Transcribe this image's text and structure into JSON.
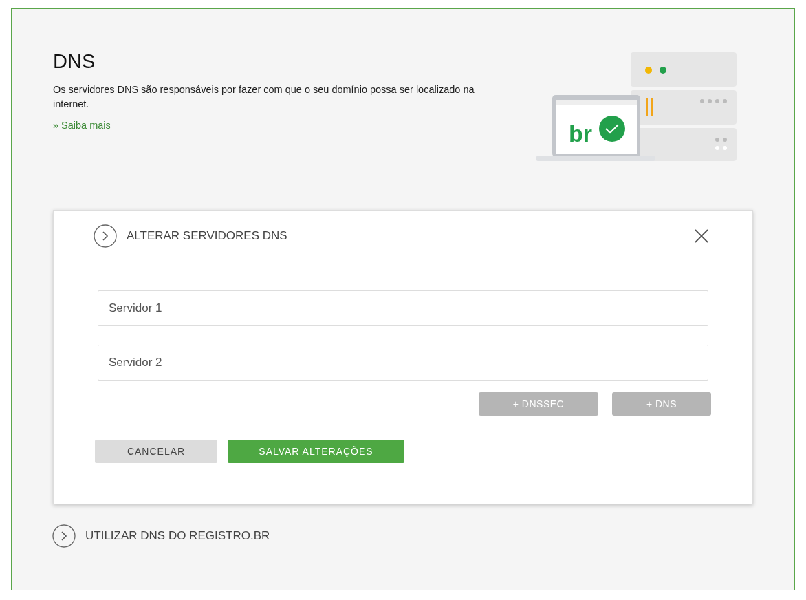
{
  "header": {
    "title": "DNS",
    "description": "Os servidores DNS são responsáveis por fazer com que o seu domínio possa ser localizado na internet.",
    "link": "» Saiba mais",
    "illustration_text": "br"
  },
  "panel": {
    "title": "ALTERAR SERVIDORES DNS",
    "fields": [
      {
        "placeholder": "Servidor 1"
      },
      {
        "placeholder": "Servidor 2"
      }
    ],
    "add_buttons": [
      "+ DNSSEC",
      "+ DNS"
    ],
    "cancel": "CANCELAR",
    "save": "SALVAR ALTERAÇÕES"
  },
  "option": {
    "title": "UTILIZAR DNS DO REGISTRO.BR"
  }
}
